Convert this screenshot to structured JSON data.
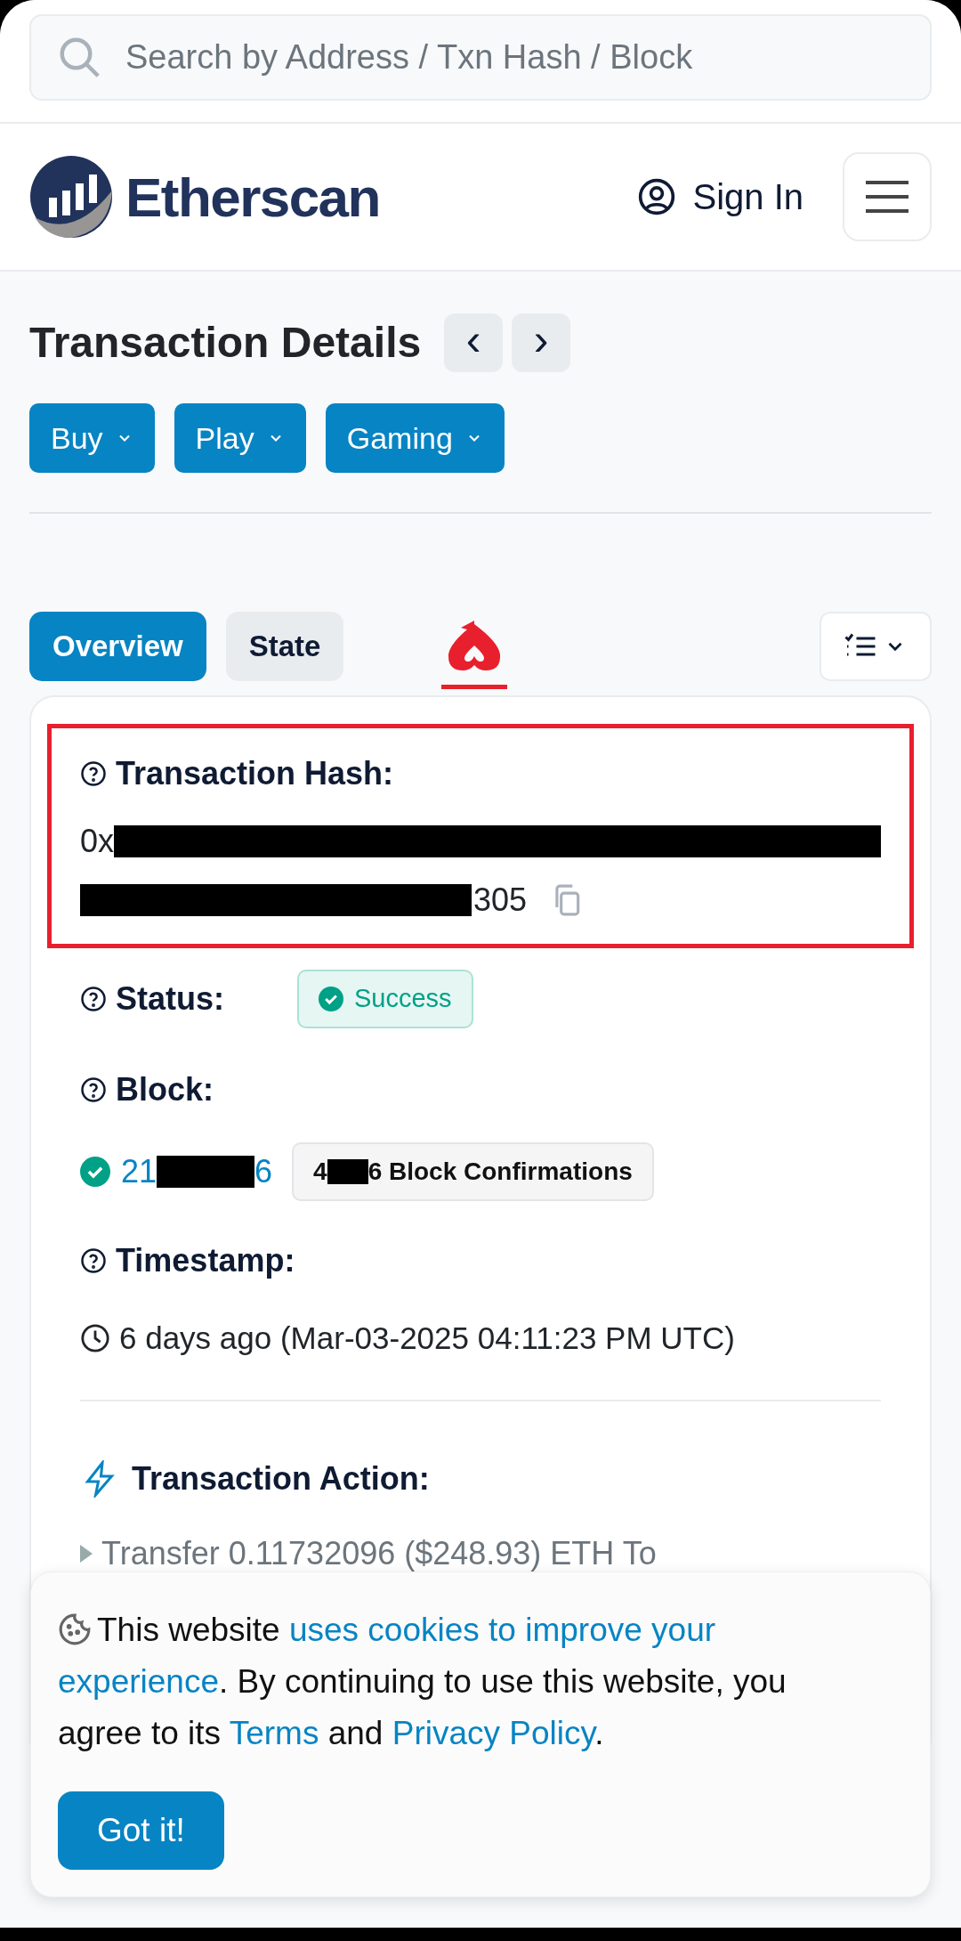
{
  "search": {
    "placeholder": "Search by Address / Txn Hash / Block"
  },
  "header": {
    "logo_text": "Etherscan",
    "sign_in": "Sign In"
  },
  "page": {
    "title": "Transaction Details",
    "prev": "‹",
    "next": "›"
  },
  "menus": [
    {
      "label": "Buy"
    },
    {
      "label": "Play"
    },
    {
      "label": "Gaming"
    }
  ],
  "tabs": [
    {
      "label": "Overview",
      "selected": true
    },
    {
      "label": "State",
      "selected": false
    }
  ],
  "details": {
    "hash_label": "Transaction Hash:",
    "hash_start": "0x",
    "hash_end": "305",
    "status_label": "Status:",
    "status": "Success",
    "block_label": "Block:",
    "block_start": "21",
    "block_end": "6",
    "confirm_start": "4",
    "confirm_end": "6 Block Confirmations",
    "timestamp_label": "Timestamp:",
    "timestamp": "6 days ago (Mar-03-2025 04:11:23 PM UTC)",
    "action_label": "Transaction Action:",
    "action": "Transfer 0.11732096 ($248.93) ETH To"
  },
  "cookie": {
    "text_1": "This website ",
    "link_1": [
      "uses cookies to improve your",
      "experience"
    ],
    "text_2": ". By continuing to use this website, you agree to its ",
    "link_2": "Terms",
    "text_3": " and ",
    "link_3": "Privacy Policy",
    "text_4": ".",
    "button": "Got it!"
  }
}
